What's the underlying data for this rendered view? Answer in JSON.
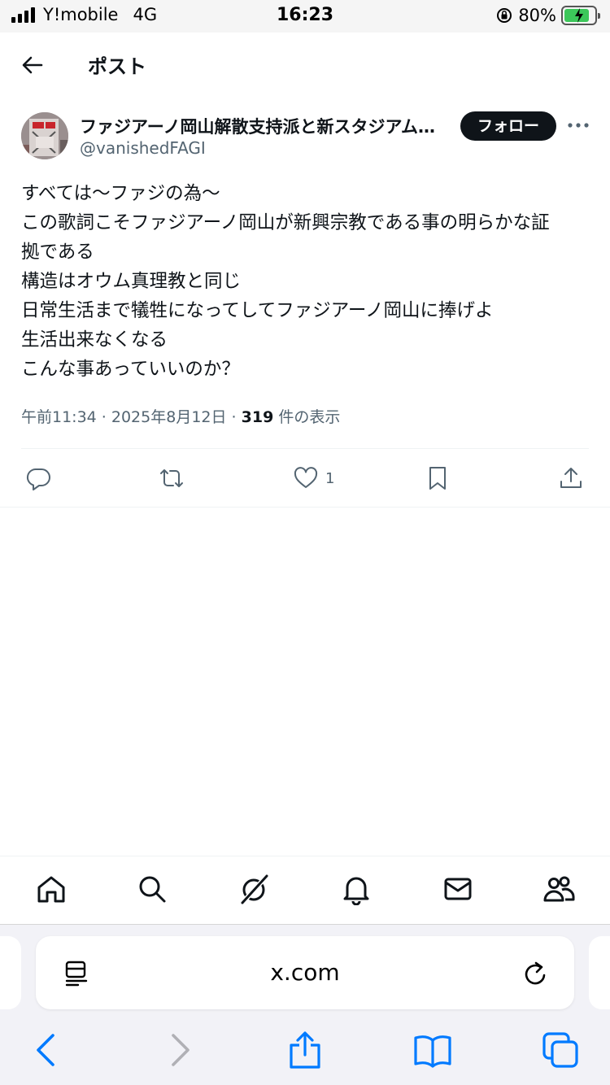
{
  "status_bar": {
    "carrier": "Y!mobile",
    "network": "4G",
    "time": "16:23",
    "battery_percent": "80%",
    "battery_level": 0.8
  },
  "header": {
    "title": "ポスト",
    "back_icon": "arrow-left-icon"
  },
  "tweet": {
    "author": {
      "display_name": "ファジアーノ岡山解散支持派と新スタジアム…",
      "handle": "@vanishedFAGI",
      "follow_label": "フォロー"
    },
    "text_lines": [
      "すべては〜ファジの為〜",
      "この歌詞こそファジアーノ岡山が新興宗教である事の明らかな証",
      "拠である",
      "構造はオウム真理教と同じ",
      "日常生活まで犠牲になってしてファジアーノ岡山に捧げよ",
      "生活出来なくなる",
      "こんな事あっていいのか？"
    ],
    "timestamp": "午前11:34 · 2025年8月12日 · ",
    "views_count": "319",
    "views_label": " 件の表示",
    "actions": {
      "reply": {
        "icon": "reply-icon",
        "count": ""
      },
      "repost": {
        "icon": "repost-icon",
        "count": ""
      },
      "like": {
        "icon": "heart-icon",
        "count": "1"
      },
      "bookmark": {
        "icon": "bookmark-icon",
        "count": ""
      },
      "share": {
        "icon": "share-icon",
        "count": ""
      }
    }
  },
  "bottom_nav": [
    "home-icon",
    "search-icon",
    "grok-icon",
    "notifications-icon",
    "messages-icon",
    "communities-icon"
  ],
  "safari": {
    "url": "x.com",
    "toolbar": [
      "back-icon",
      "forward-icon",
      "share-icon",
      "bookmarks-icon",
      "tabs-icon"
    ]
  },
  "colors": {
    "text": "#0f1419",
    "secondary": "#536471",
    "safari_blue": "#007aff",
    "battery_green": "#3cc75a"
  }
}
